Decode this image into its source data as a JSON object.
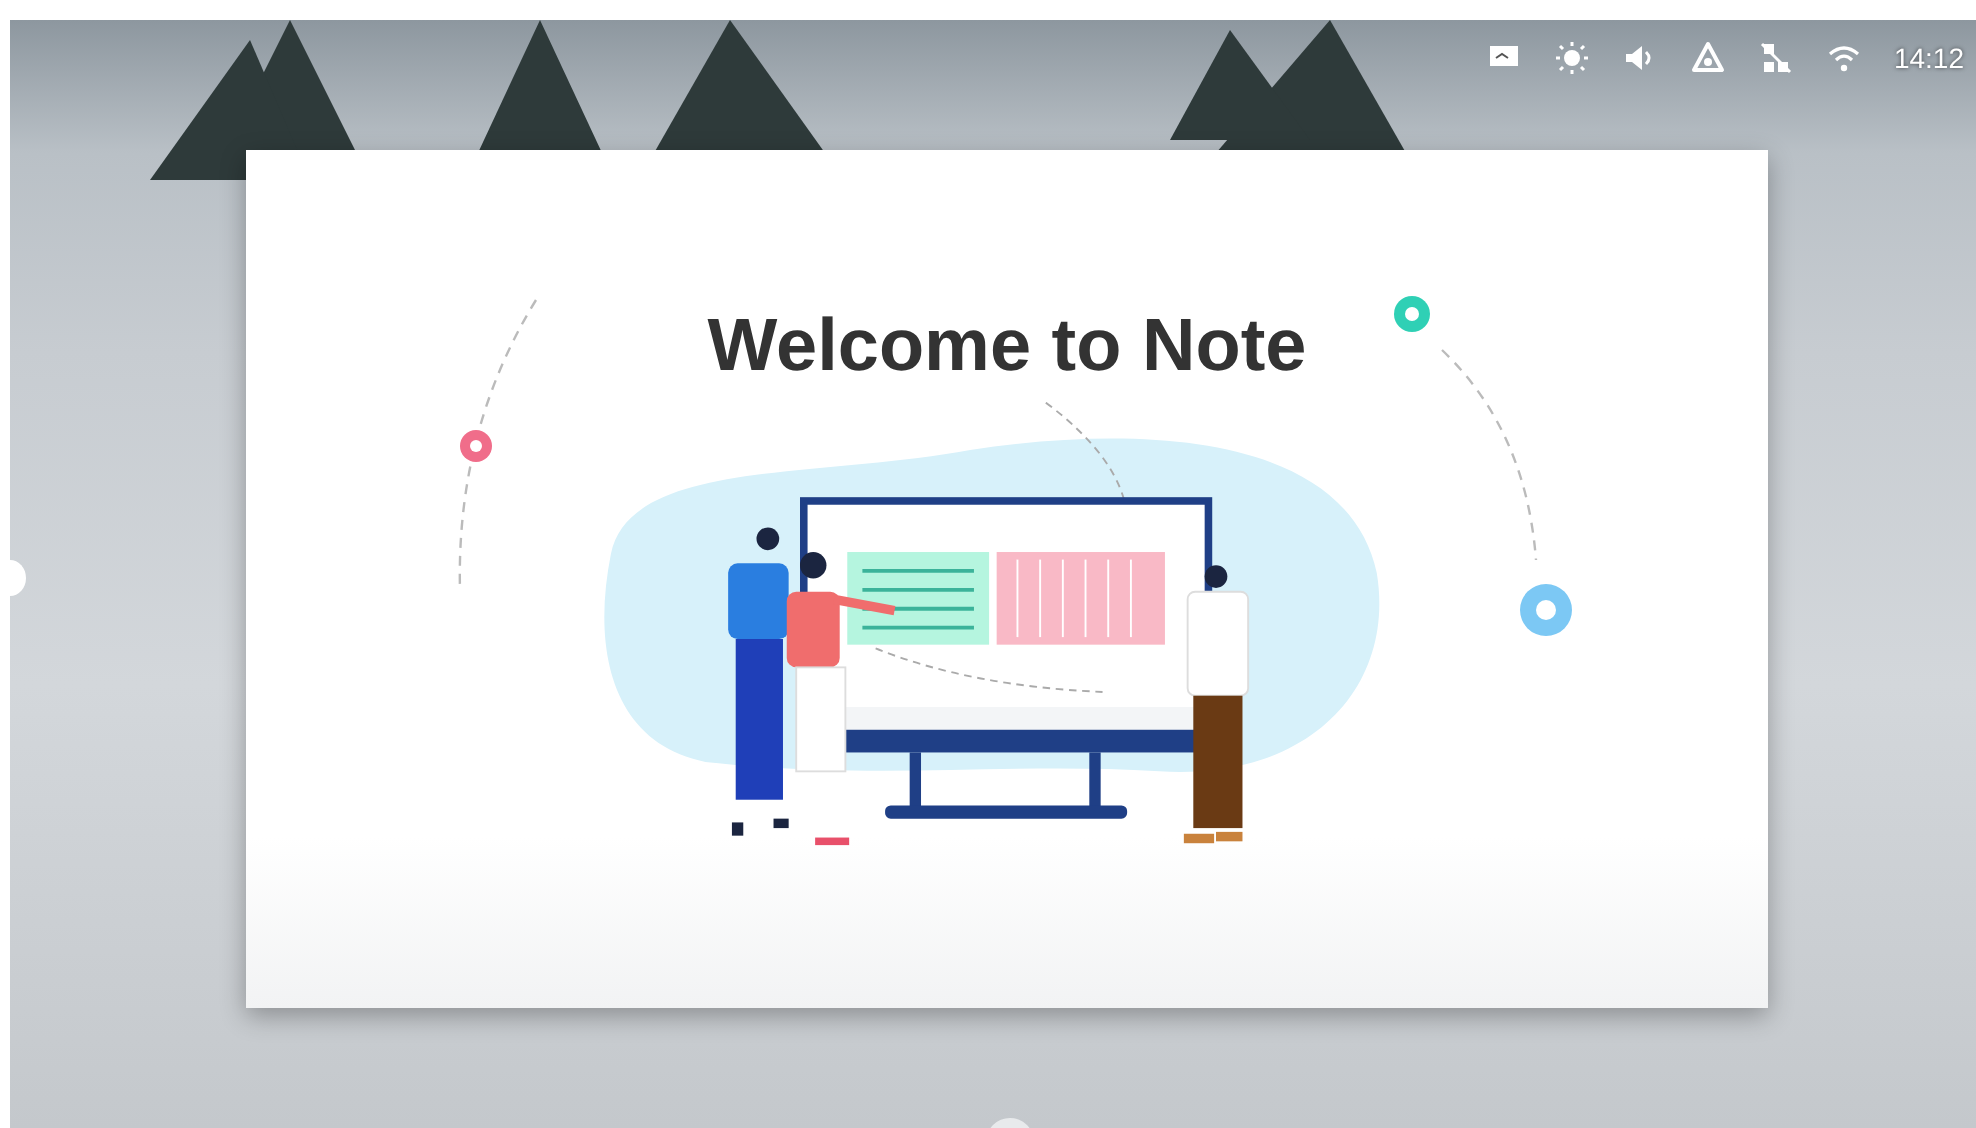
{
  "status_bar": {
    "time": "14:12"
  },
  "slide": {
    "title": "Welcome to Note"
  }
}
